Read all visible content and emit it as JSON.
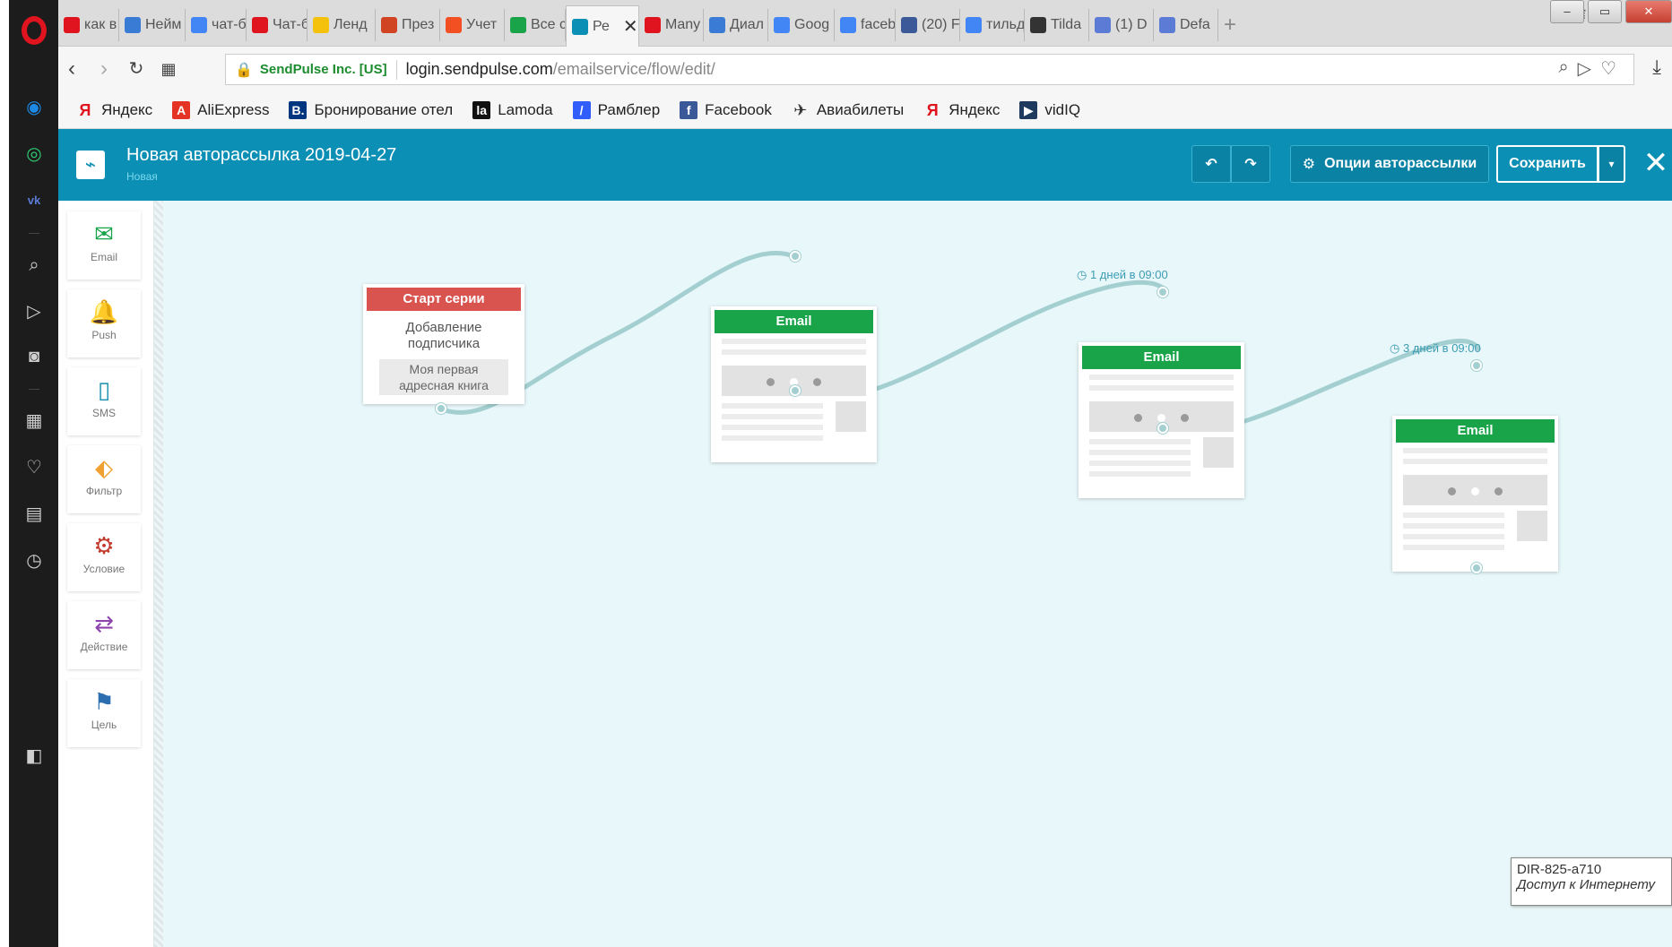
{
  "browser": {
    "tabs": [
      {
        "label": "как в",
        "color": "#e0141e"
      },
      {
        "label": "Нейм",
        "color": "#3a7bd5"
      },
      {
        "label": "чат-б",
        "color": "#4285f4"
      },
      {
        "label": "Чат-б",
        "color": "#e0141e"
      },
      {
        "label": "Ленд",
        "color": "#f4c20d"
      },
      {
        "label": "През",
        "color": "#d04423"
      },
      {
        "label": "Учет",
        "color": "#f25022"
      },
      {
        "label": "Все с",
        "color": "#1aa44a"
      },
      {
        "label": "Ре",
        "color": "#0c8fb4",
        "active": true
      },
      {
        "label": "Many",
        "color": "#e0141e"
      },
      {
        "label": "Диал",
        "color": "#3a7bd5"
      },
      {
        "label": "Goog",
        "color": "#4285f4"
      },
      {
        "label": "faceb",
        "color": "#4285f4"
      },
      {
        "label": "(20) F",
        "color": "#3b5998"
      },
      {
        "label": "тильд",
        "color": "#4285f4"
      },
      {
        "label": "Tilda",
        "color": "#333333"
      },
      {
        "label": "(1) D",
        "color": "#5b7bd5"
      },
      {
        "label": "Defa",
        "color": "#5b7bd5"
      }
    ],
    "tab_close": "✕",
    "new_tab": "+",
    "window_controls": {
      "minimize": "‒",
      "maximize": "▭",
      "close": "✕"
    },
    "address": {
      "site_name": "SendPulse Inc. [US]",
      "host": "login.sendpulse.com",
      "path": "/emailservice/flow/edit/"
    },
    "bookmarks": [
      {
        "label": "Яндекс",
        "icon": "yandex-icon",
        "glyph": "Я",
        "color": "#e0141e"
      },
      {
        "label": "AliExpress",
        "icon": "aliexpress-icon",
        "glyph": "A",
        "color": "#e43225"
      },
      {
        "label": "Бронирование отел",
        "icon": "booking-icon",
        "glyph": "B.",
        "color": "#003580"
      },
      {
        "label": "Lamoda",
        "icon": "lamoda-icon",
        "glyph": "la",
        "color": "#111111"
      },
      {
        "label": "Рамблер",
        "icon": "rambler-icon",
        "glyph": "/",
        "color": "#315efb"
      },
      {
        "label": "Facebook",
        "icon": "facebook-icon",
        "glyph": "f",
        "color": "#3b5998"
      },
      {
        "label": "Авиабилеты",
        "icon": "plane-icon",
        "glyph": "✈",
        "color": "#333333"
      },
      {
        "label": "Яндекс",
        "icon": "yandex-icon",
        "glyph": "Я",
        "color": "#e0141e"
      },
      {
        "label": "vidIQ",
        "icon": "vidiq-icon",
        "glyph": "▶",
        "color": "#1e3a5f"
      }
    ]
  },
  "editor": {
    "title": "Новая авторассылка 2019-04-27",
    "status": "Новая",
    "undo": "↶",
    "redo": "↷",
    "options_label": "Опции авторассылки",
    "save_label": "Сохранить",
    "close": "✕"
  },
  "toolbox": [
    {
      "label": "Email",
      "glyph": "✉",
      "color": "#1aa44a",
      "icon": "email-icon"
    },
    {
      "label": "Push",
      "glyph": "🔔",
      "color": "#4a90a4",
      "icon": "bell-icon"
    },
    {
      "label": "SMS",
      "glyph": "▯",
      "color": "#1a8fb0",
      "icon": "phone-icon"
    },
    {
      "label": "Фильтр",
      "glyph": "⬖",
      "color": "#f0a030",
      "icon": "filter-icon"
    },
    {
      "label": "Условие",
      "glyph": "⚙",
      "color": "#c0392b",
      "icon": "condition-icon"
    },
    {
      "label": "Действие",
      "glyph": "⇄",
      "color": "#8e44ad",
      "icon": "action-icon"
    },
    {
      "label": "Цель",
      "glyph": "⚑",
      "color": "#2c6fb0",
      "icon": "flag-icon"
    }
  ],
  "flow": {
    "start": {
      "header": "Старт серии",
      "event": "Добавление подписчика",
      "book": "Моя первая адресная книга"
    },
    "emails": [
      {
        "header": "Email",
        "delay": ""
      },
      {
        "header": "Email",
        "delay": "1 дней в 09:00"
      },
      {
        "header": "Email",
        "delay": "3 дней в 09:00"
      }
    ]
  },
  "network_tooltip": {
    "name": "DIR-825-a710",
    "status": "Доступ к Интернету"
  }
}
